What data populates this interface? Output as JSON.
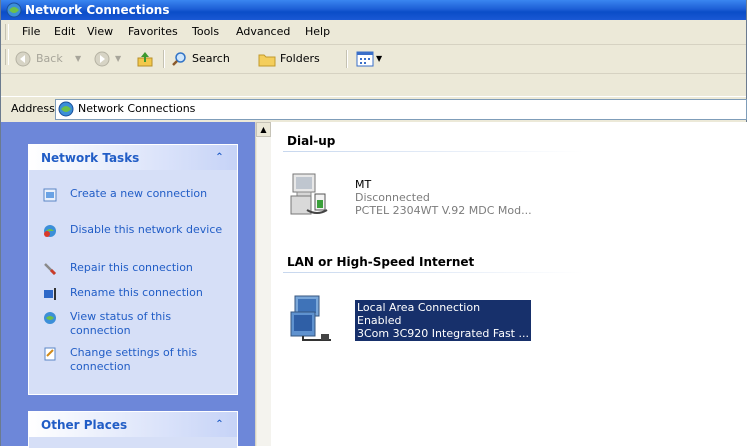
{
  "window": {
    "title": "Network Connections"
  },
  "menu": [
    "File",
    "Edit",
    "View",
    "Favorites",
    "Tools",
    "Advanced",
    "Help"
  ],
  "toolbar": {
    "back": "Back",
    "search": "Search",
    "folders": "Folders"
  },
  "address": {
    "label": "Address",
    "value": "Network Connections"
  },
  "network_tasks": {
    "title": "Network Tasks",
    "items": [
      "Create a new connection",
      "Disable this network device",
      "Repair this connection",
      "Rename this connection",
      "View status of this connection",
      "Change settings of this connection"
    ]
  },
  "other_places": {
    "title": "Other Places"
  },
  "dialup": {
    "header": "Dial-up",
    "name": "MT",
    "status": "Disconnected",
    "device": "PCTEL 2304WT V.92 MDC Mod..."
  },
  "lan": {
    "header": "LAN or High-Speed Internet",
    "name": "Local Area Connection",
    "status": "Enabled",
    "device": "3Com 3C920 Integrated Fast ..."
  },
  "colors": {
    "title_bar": "#0a4dc8",
    "task_pane": "#6d87d9",
    "selection": "#17306b",
    "task_link": "#215dc6"
  }
}
